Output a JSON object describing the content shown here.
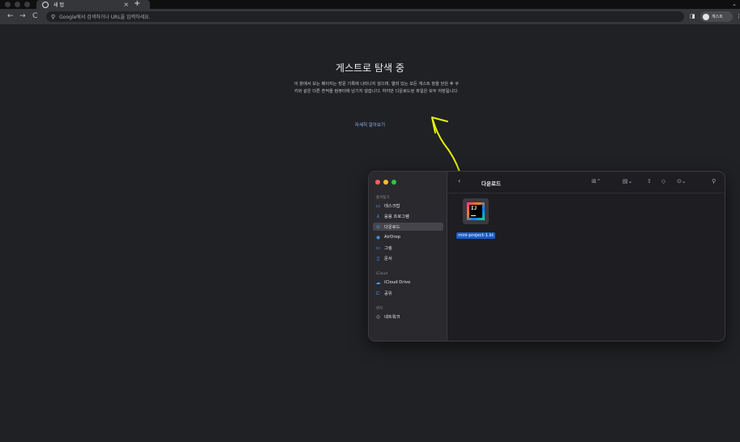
{
  "browser": {
    "tab_title": "새 탭",
    "tab_close": "×",
    "new_tab": "+",
    "tab_menu": "⌄",
    "nav_back": "←",
    "nav_forward": "→",
    "nav_reload": "C",
    "omnibox_placeholder": "Google에서 검색하거나 URL을 입력하세요.",
    "profile_label": "게스트"
  },
  "guest_page": {
    "heading": "게스트로 탐색 중",
    "paragraph": "이 창에서 보는 페이지는 방문 기록에 나타나지 않으며, 열려 있는 모든 게스트 창을 닫은 후 쿠키와 같은 다른 흔적을 컴퓨터에 남기지 않습니다. 하지만 다운로드된 파일은 모두 저장됩니다.",
    "learn_more": "자세히 알아보기"
  },
  "finder": {
    "title": "다운로드",
    "favorites_header": "즐겨찾기",
    "icloud_header": "iCloud",
    "locations_header": "위치",
    "favorites": [
      {
        "label": "데스크탑",
        "icon": "desktop-icon",
        "glyph": "▭"
      },
      {
        "label": "응용 프로그램",
        "icon": "applications-icon",
        "glyph": "⅄"
      },
      {
        "label": "다운로드",
        "icon": "downloads-icon",
        "glyph": "⊙"
      },
      {
        "label": "AirDrop",
        "icon": "airdrop-icon",
        "glyph": "◉"
      },
      {
        "label": "그림",
        "icon": "pictures-icon",
        "glyph": "▭"
      },
      {
        "label": "문서",
        "icon": "documents-icon",
        "glyph": "▯"
      }
    ],
    "icloud": [
      {
        "label": "iCloud Drive",
        "icon": "cloud-icon",
        "glyph": "☁"
      },
      {
        "label": "공유",
        "icon": "shared-folder-icon",
        "glyph": "⊏"
      }
    ],
    "locations": [
      {
        "label": "네트워크",
        "icon": "network-icon",
        "glyph": "◎"
      }
    ],
    "file": {
      "name": "mini-project-1.kt",
      "icon_text": "IJ"
    },
    "colors": {
      "red": "#ff5f57",
      "yellow": "#febc2e",
      "green": "#28c840",
      "accent": "#1a5cc7"
    }
  },
  "annotation": {
    "arrow_color": "#e6f00d"
  }
}
